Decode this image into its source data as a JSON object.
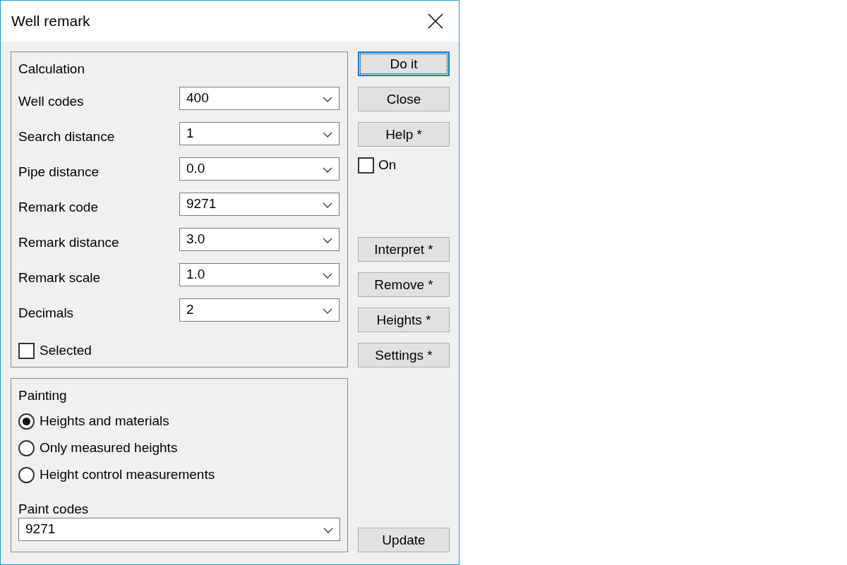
{
  "window": {
    "title": "Well remark"
  },
  "calculation": {
    "title": "Calculation",
    "fields": [
      {
        "label": "Well codes",
        "value": "400"
      },
      {
        "label": "Search distance",
        "value": "1"
      },
      {
        "label": "Pipe distance",
        "value": "0.0"
      },
      {
        "label": "Remark code",
        "value": "9271"
      },
      {
        "label": "Remark distance",
        "value": "3.0"
      },
      {
        "label": "Remark scale",
        "value": "1.0"
      },
      {
        "label": "Decimals",
        "value": "2"
      }
    ],
    "selected_checkbox": {
      "label": "Selected",
      "checked": false
    }
  },
  "painting": {
    "title": "Painting",
    "options": [
      {
        "label": "Heights and materials",
        "selected": true
      },
      {
        "label": "Only measured heights",
        "selected": false
      },
      {
        "label": "Height control measurements",
        "selected": false
      }
    ],
    "paint_codes": {
      "label": "Paint codes",
      "value": "9271"
    }
  },
  "side": {
    "top_buttons": [
      {
        "label": "Do it",
        "focused": true
      },
      {
        "label": "Close",
        "focused": false
      },
      {
        "label": "Help *",
        "focused": false
      }
    ],
    "on_checkbox": {
      "label": "On",
      "checked": false
    },
    "tool_buttons": [
      {
        "label": "Interpret *",
        "focused": false
      },
      {
        "label": "Remove *",
        "focused": false
      },
      {
        "label": "Heights *",
        "focused": false
      },
      {
        "label": "Settings *",
        "focused": false
      }
    ],
    "update_button": {
      "label": "Update",
      "focused": false
    }
  }
}
